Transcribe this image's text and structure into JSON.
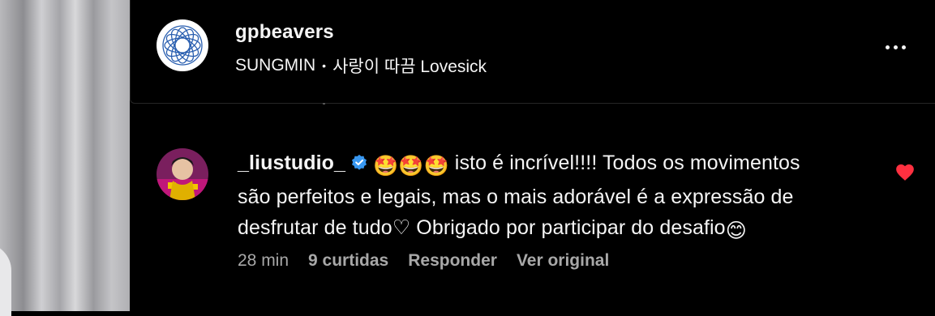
{
  "header": {
    "username": "gpbeavers",
    "artist": "SUNGMIN",
    "separator": "•",
    "song": "사랑이 따끔 Lovesick"
  },
  "comment": {
    "username": "_liustudio_",
    "emojis": "🤩🤩🤩",
    "text_line1": " isto é incrível!!!! Todos os movimentos",
    "text_line2": "são perfeitos e legais, mas o mais adorável é a expressão de",
    "text_line3": "desfrutar de tudo♡ Obrigado por participar do desafio",
    "trailing_emoji": "😊",
    "time": "28 min",
    "likes": "9 curtidas",
    "reply_label": "Responder",
    "translate_label": "Ver original",
    "liked": true
  },
  "colors": {
    "background": "#000000",
    "text": "#f5f5f5",
    "secondary": "#a8a8a8",
    "verified": "#3897f0",
    "heart": "#ff3040"
  },
  "icons": [
    "more-icon",
    "verified-badge-icon",
    "heart-icon"
  ]
}
